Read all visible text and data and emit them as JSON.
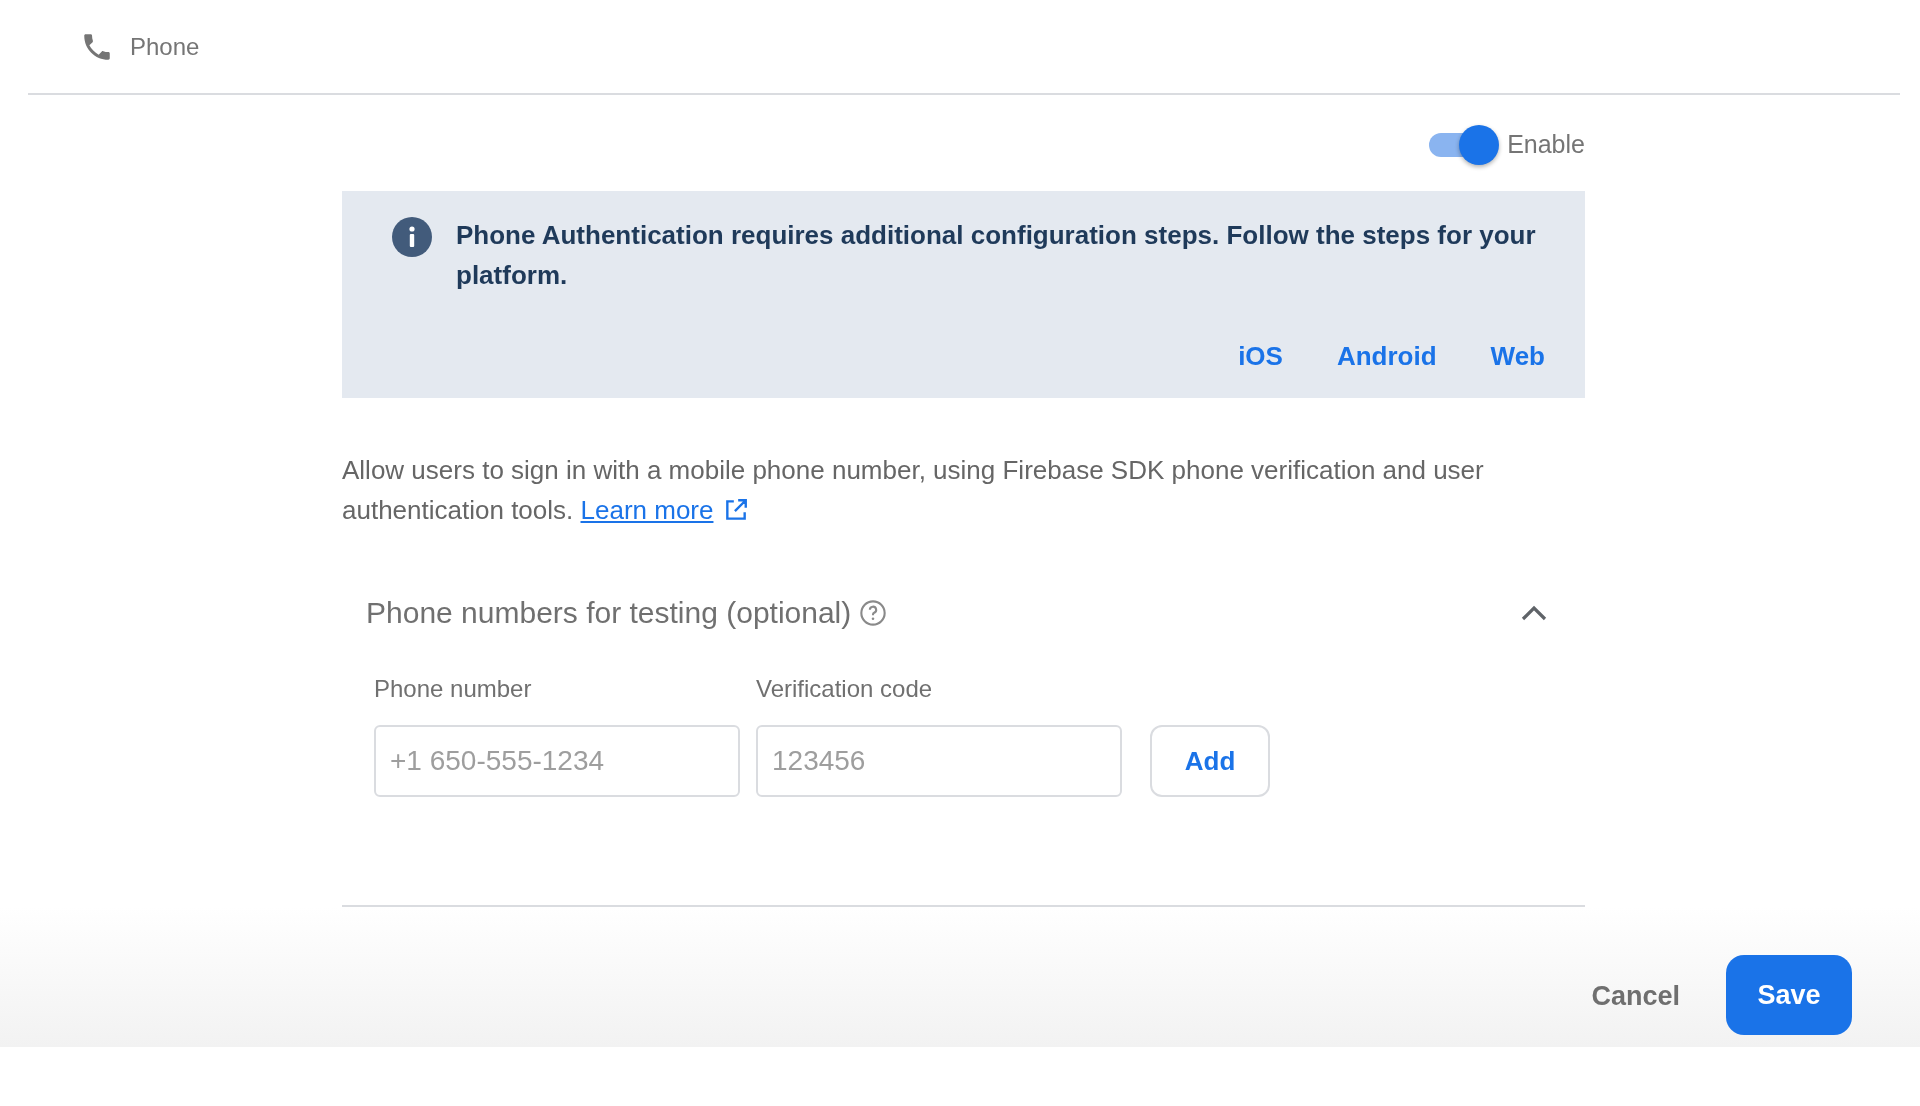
{
  "header": {
    "title": "Phone"
  },
  "toggle": {
    "label": "Enable",
    "on": true
  },
  "info": {
    "message": "Phone Authentication requires additional configuration steps. Follow the steps for your platform.",
    "links": [
      "iOS",
      "Android",
      "Web"
    ]
  },
  "description": {
    "text": "Allow users to sign in with a mobile phone number, using Firebase SDK phone verification and user authentication tools.",
    "link": "Learn more"
  },
  "testing": {
    "title": "Phone numbers for testing (optional)",
    "expanded": true,
    "fields": [
      {
        "label": "Phone number",
        "placeholder": "+1 650-555-1234"
      },
      {
        "label": "Verification code",
        "placeholder": "123456"
      }
    ],
    "add_button": "Add"
  },
  "buttons": [
    "Cancel",
    "Save"
  ]
}
